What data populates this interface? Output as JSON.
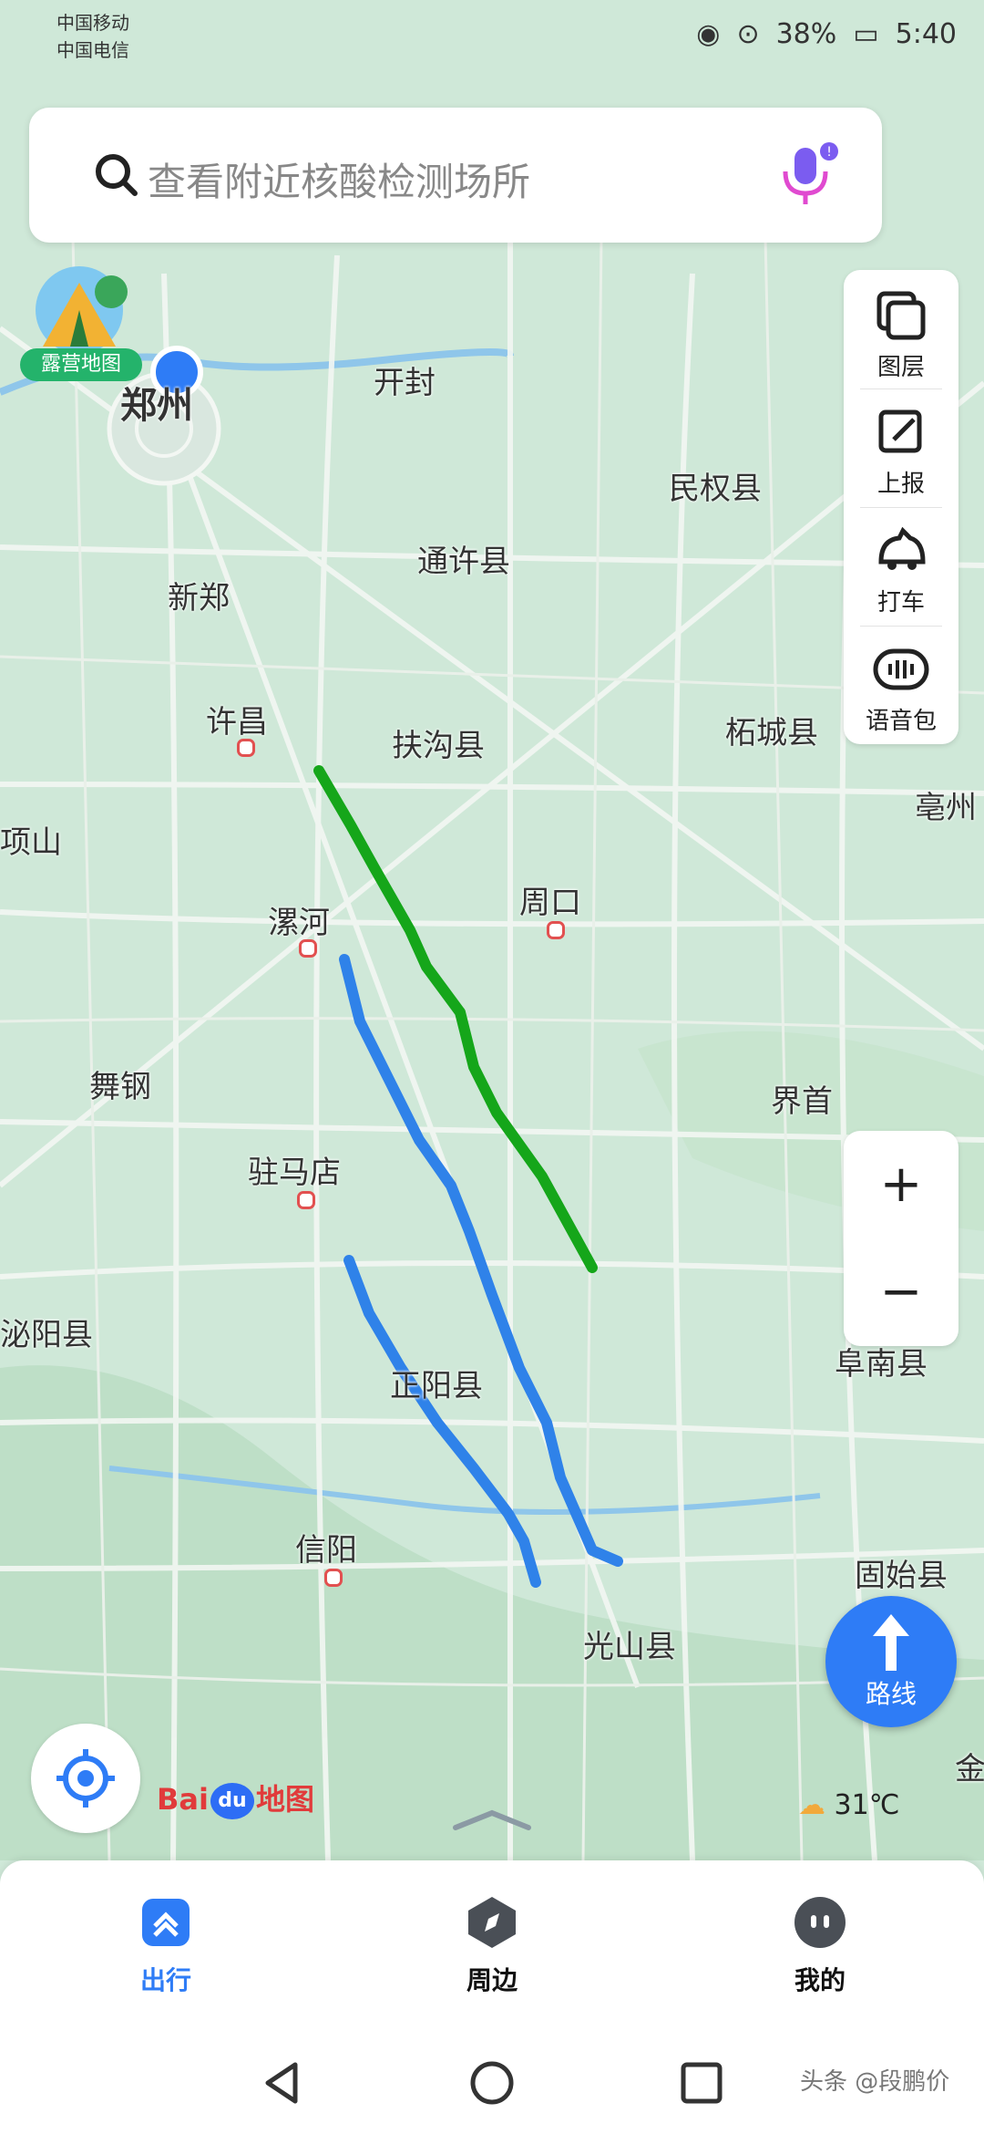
{
  "status_bar": {
    "carrier1": "中国移动",
    "carrier2": "中国电信",
    "battery": "38%",
    "time": "5:40"
  },
  "search": {
    "placeholder": "查看附近核酸检测场所"
  },
  "camping_badge": {
    "label": "露营地图"
  },
  "side_tools": [
    {
      "label": "图层",
      "icon": "layers-icon"
    },
    {
      "label": "上报",
      "icon": "report-icon"
    },
    {
      "label": "打车",
      "icon": "taxi-icon"
    },
    {
      "label": "语音包",
      "icon": "voice-pack-icon"
    }
  ],
  "zoom": {
    "in": "+",
    "out": "−"
  },
  "route_button": {
    "label": "路线"
  },
  "logo": {
    "text_left": "Bai",
    "text_mid": "du",
    "text_right": "地图"
  },
  "weather": {
    "temperature": "31℃",
    "icon": "partly-cloudy-icon"
  },
  "map_labels": [
    "郑州",
    "开封",
    "民权县",
    "通许县",
    "新郑",
    "许昌",
    "扶沟县",
    "柘城县",
    "亳州",
    "项山",
    "周口",
    "漯河",
    "舞钢",
    "界首",
    "驻马店",
    "泌阳县",
    "正阳县",
    "阜南县",
    "信阳",
    "固始县",
    "光山县",
    "金"
  ],
  "route_colors": {
    "green": "#15a61a",
    "blue": "#2f82e9"
  },
  "tabs": [
    {
      "label": "出行",
      "icon": "travel-icon",
      "active": true
    },
    {
      "label": "周边",
      "icon": "compass-icon",
      "active": false
    },
    {
      "label": "我的",
      "icon": "profile-icon",
      "active": false
    }
  ],
  "watermark": "头条 @段鹏价"
}
